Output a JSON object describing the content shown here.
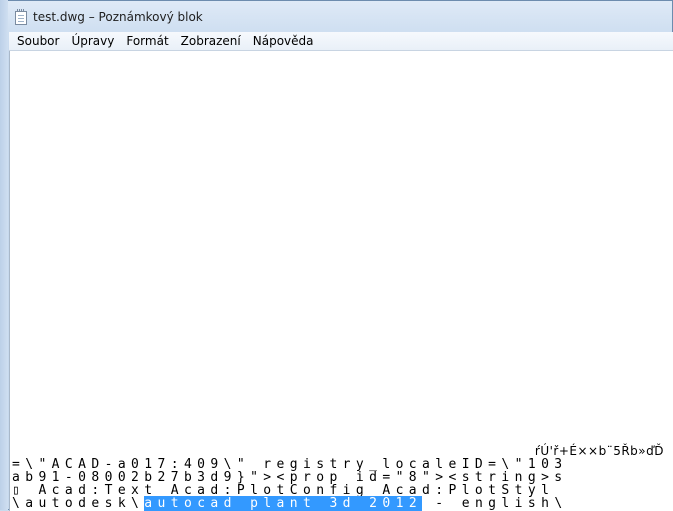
{
  "window": {
    "title": "test.dwg – Poznámkový blok"
  },
  "menubar": {
    "items": [
      "Soubor",
      "Úpravy",
      "Formát",
      "Zobrazení",
      "Nápověda"
    ]
  },
  "editor": {
    "garbled_text": "ŕÚ'ř+É××b¨5Řb»ďĎ",
    "line1": "=\\\"ACAD-a017:409\\\" registry_localeID=\\\"103",
    "line2": "ab91-08002b27b3d9}\"><prop id=\"8\"><string>s",
    "line3": "▯ Acad:Text Acad:PlotConfig Acad:PlotStyl",
    "line4_before": "\\autodesk\\",
    "line4_selected": "autocad plant 3d 2012",
    "line4_after": " - english\\"
  }
}
